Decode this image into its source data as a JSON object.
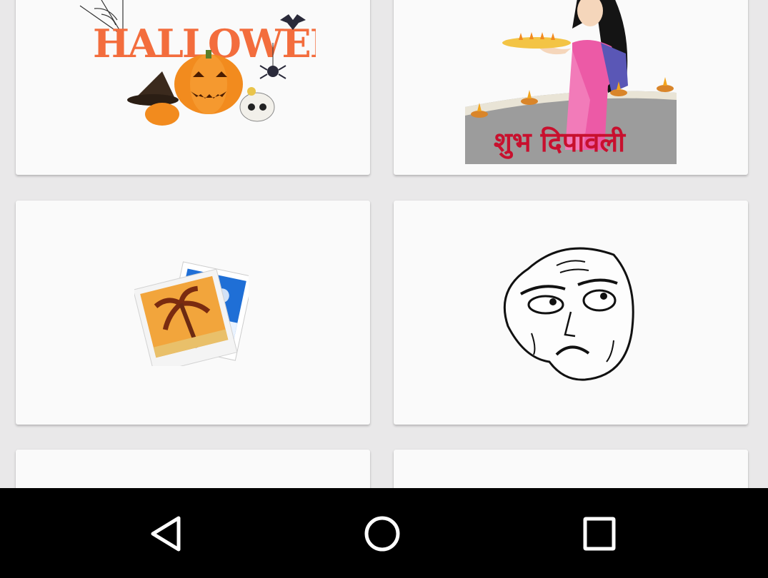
{
  "cards": [
    {
      "name": "halloween-sticker",
      "text": "HALLOWEEN"
    },
    {
      "name": "diwali-sticker",
      "text": "शुभ दिपावली"
    },
    {
      "name": "gallery-photos-sticker"
    },
    {
      "name": "rage-face-sticker"
    },
    {
      "name": "sticker-card-5"
    },
    {
      "name": "sticker-card-6"
    }
  ],
  "navbar": {
    "back": "back-icon",
    "home": "home-icon",
    "recents": "recents-icon"
  }
}
